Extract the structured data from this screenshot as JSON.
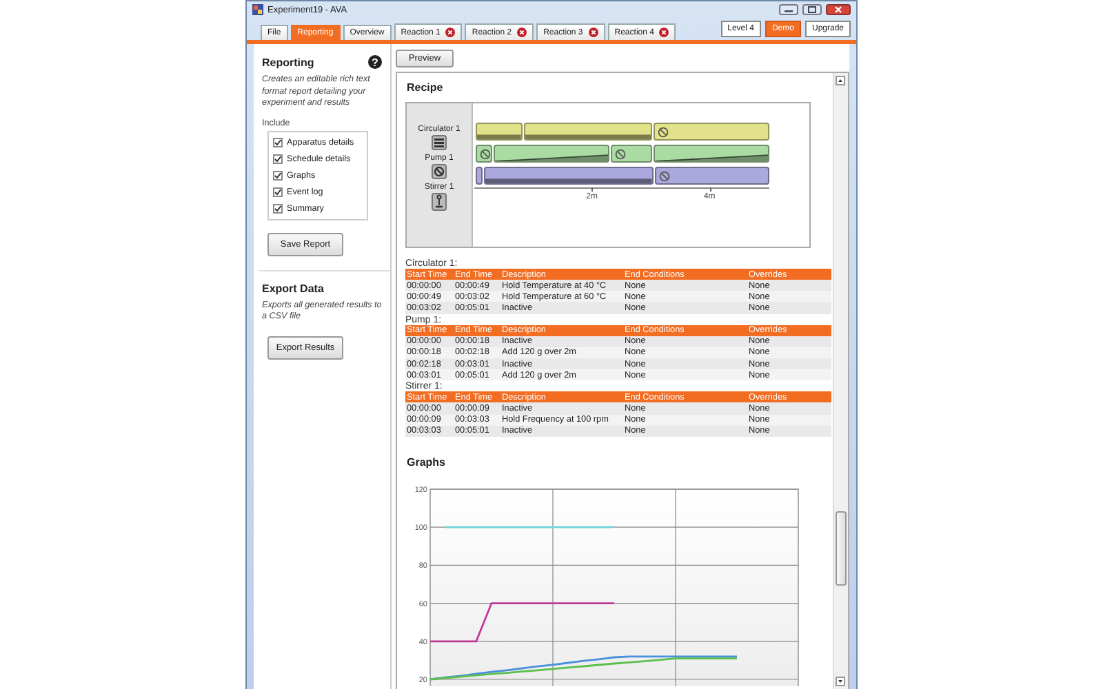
{
  "window": {
    "title": "Experiment19 - AVA"
  },
  "tabs": [
    {
      "label": "File",
      "selected": false,
      "closable": false
    },
    {
      "label": "Reporting",
      "selected": true,
      "closable": false
    },
    {
      "label": "Overview",
      "selected": false,
      "closable": false
    },
    {
      "label": "Reaction 1",
      "selected": false,
      "closable": true
    },
    {
      "label": "Reaction 2",
      "selected": false,
      "closable": true
    },
    {
      "label": "Reaction 3",
      "selected": false,
      "closable": true
    },
    {
      "label": "Reaction 4",
      "selected": false,
      "closable": true
    }
  ],
  "header_buttons": [
    {
      "label": "Level 4",
      "kind": "plain"
    },
    {
      "label": "Demo",
      "kind": "accent"
    },
    {
      "label": "Upgrade",
      "kind": "plain"
    }
  ],
  "reporting": {
    "title": "Reporting",
    "help_icon": "?",
    "description": "Creates an editable rich text format report detailing your experiment and results",
    "include_label": "Include",
    "options": [
      {
        "label": "Apparatus details",
        "checked": true
      },
      {
        "label": "Schedule details",
        "checked": true
      },
      {
        "label": "Graphs",
        "checked": true
      },
      {
        "label": "Event log",
        "checked": true
      },
      {
        "label": "Summary",
        "checked": true
      }
    ],
    "button": "Save Report"
  },
  "export": {
    "title": "Export Data",
    "description": "Exports all generated results to a CSV file",
    "button": "Export Results"
  },
  "preview_button": "Preview",
  "recipe": {
    "title": "Recipe",
    "timeline": {
      "devices": [
        {
          "label": "Circulator 1",
          "kind": "circulator"
        },
        {
          "label": "Pump 1",
          "kind": "pump"
        },
        {
          "label": "Stirrer 1",
          "kind": "stirrer"
        }
      ],
      "axis_labels": [
        "2m",
        "4m"
      ]
    },
    "schedules": [
      {
        "title": "Circulator 1:",
        "color": "#e2e28a",
        "columns": [
          "Start Time",
          "End Time",
          "Description",
          "End Conditions",
          "Overrides"
        ],
        "rows": [
          {
            "kind": "hold",
            "cells": [
              "00:00:00",
              "00:00:49",
              "Hold Temperature at 40 °C",
              "None",
              "None"
            ]
          },
          {
            "kind": "hold",
            "cells": [
              "00:00:49",
              "00:03:02",
              "Hold Temperature at 60 °C",
              "None",
              "None"
            ]
          },
          {
            "kind": "inactive",
            "cells": [
              "00:03:02",
              "00:05:01",
              "Inactive",
              "None",
              "None"
            ]
          }
        ]
      },
      {
        "title": "Pump 1:",
        "color": "#a9dba2",
        "columns": [
          "Start Time",
          "End Time",
          "Description",
          "End Conditions",
          "Overrides"
        ],
        "rows": [
          {
            "kind": "inactive",
            "cells": [
              "00:00:00",
              "00:00:18",
              "Inactive",
              "None",
              "None"
            ]
          },
          {
            "kind": "ramp",
            "cells": [
              "00:00:18",
              "00:02:18",
              "Add 120 g over 2m",
              "None",
              "None"
            ]
          },
          {
            "kind": "inactive",
            "cells": [
              "00:02:18",
              "00:03:01",
              "Inactive",
              "None",
              "None"
            ]
          },
          {
            "kind": "ramp",
            "cells": [
              "00:03:01",
              "00:05:01",
              "Add 120 g over 2m",
              "None",
              "None"
            ]
          }
        ]
      },
      {
        "title": "Stirrer 1:",
        "color": "#aaa8dc",
        "columns": [
          "Start Time",
          "End Time",
          "Description",
          "End Conditions",
          "Overrides"
        ],
        "rows": [
          {
            "kind": "inactive",
            "cells": [
              "00:00:00",
              "00:00:09",
              "Inactive",
              "None",
              "None"
            ]
          },
          {
            "kind": "hold",
            "cells": [
              "00:00:09",
              "00:03:03",
              "Hold Frequency at 100 rpm",
              "None",
              "None"
            ]
          },
          {
            "kind": "inactive",
            "cells": [
              "00:03:03",
              "00:05:01",
              "Inactive",
              "None",
              "None"
            ]
          }
        ]
      }
    ]
  },
  "graphs": {
    "title": "Graphs",
    "chart_data": {
      "type": "line",
      "categories": [
        null,
        null,
        null,
        null,
        null,
        null,
        null,
        null,
        null,
        null,
        null,
        null,
        null,
        null,
        null,
        null,
        null,
        null,
        null,
        null,
        null,
        null,
        null,
        null,
        null
      ],
      "grid": true,
      "ylim": [
        20,
        120
      ],
      "yticks": [
        20,
        40,
        60,
        80,
        100,
        120
      ],
      "series": [
        {
          "color": "#6fd3dc",
          "values": [
            null,
            100,
            100,
            100,
            100,
            100,
            100,
            100,
            100,
            100,
            100,
            100,
            100,
            null,
            null,
            null,
            null,
            null,
            null,
            null,
            null,
            null,
            null,
            null,
            null
          ]
        },
        {
          "color": "#c0399a",
          "values": [
            40,
            40,
            40,
            40,
            60,
            60,
            60,
            60,
            60,
            60,
            60,
            60,
            60,
            null,
            null,
            null,
            null,
            null,
            null,
            null,
            null,
            null,
            null,
            null,
            null
          ]
        },
        {
          "color": "#4a8fdc",
          "values": [
            20,
            21,
            21.9,
            22.9,
            23.9,
            24.8,
            25.8,
            26.8,
            27.7,
            28.7,
            29.7,
            30.6,
            31.6,
            32,
            32,
            32,
            32,
            32,
            32,
            32,
            32,
            null,
            null,
            null,
            null
          ]
        },
        {
          "color": "#5cbf4c",
          "values": [
            20,
            20.7,
            21.4,
            22.1,
            22.8,
            23.4,
            24.1,
            24.8,
            25.5,
            26.2,
            26.9,
            27.6,
            28.3,
            28.9,
            29.6,
            30.3,
            31,
            31,
            31,
            31,
            31,
            null,
            null,
            null,
            null
          ]
        }
      ]
    }
  }
}
